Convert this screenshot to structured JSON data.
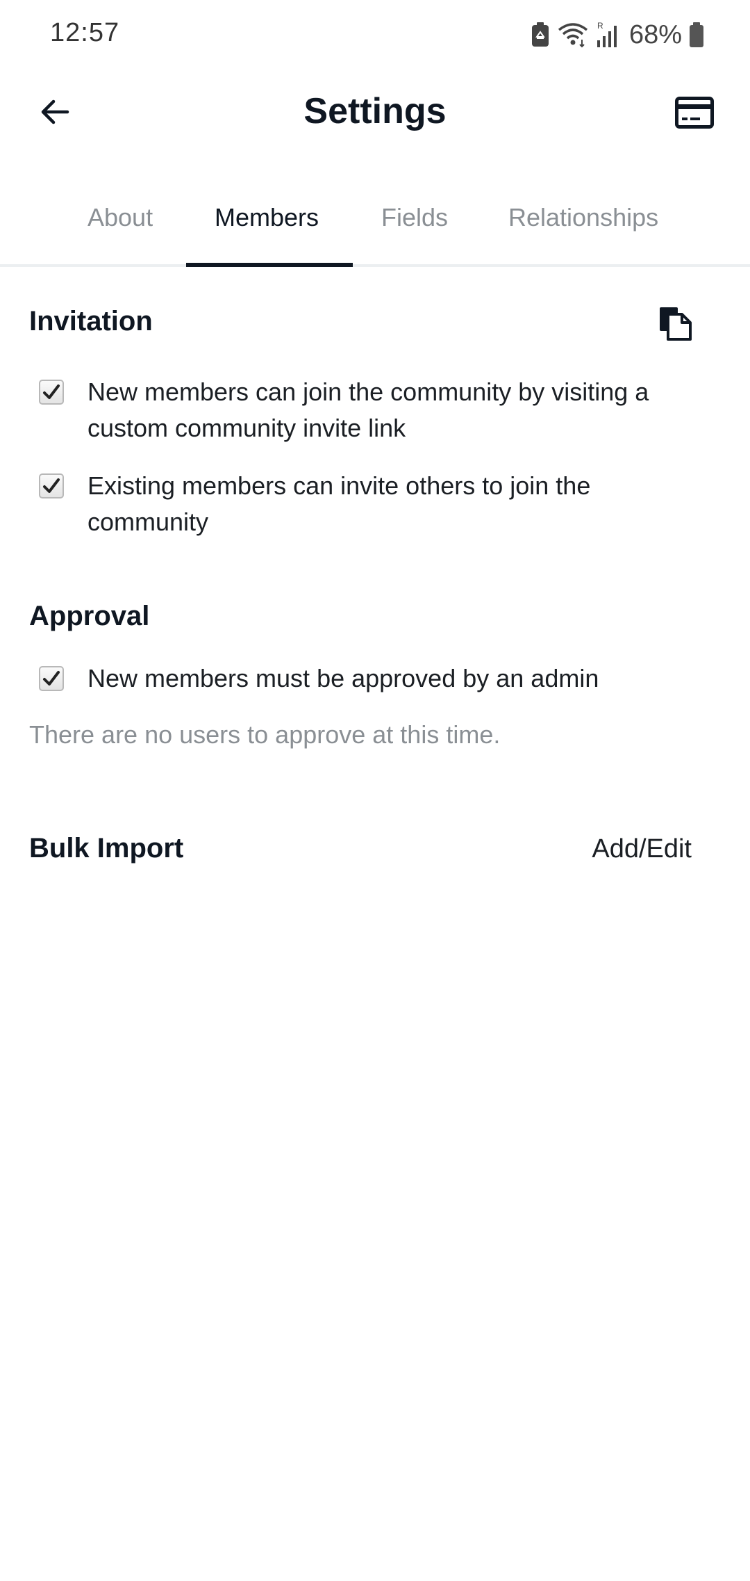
{
  "status_bar": {
    "time": "12:57",
    "battery": "68%",
    "icons": [
      "battery-saver-icon",
      "wifi-icon",
      "signal-icon",
      "battery-icon"
    ]
  },
  "header": {
    "title": "Settings",
    "back_icon": "arrow-left-icon",
    "action_icon": "credit-card-icon"
  },
  "tabs": [
    {
      "label": "About",
      "active": false
    },
    {
      "label": "Members",
      "active": true
    },
    {
      "label": "Fields",
      "active": false
    },
    {
      "label": "Relationships",
      "active": false
    }
  ],
  "invitation": {
    "title": "Invitation",
    "copy_icon": "copy-icon",
    "options": [
      {
        "label": "New members can join the community by visiting a custom community invite link",
        "checked": true
      },
      {
        "label": "Existing members can invite others to join the community",
        "checked": true
      }
    ]
  },
  "approval": {
    "title": "Approval",
    "option": {
      "label": "New members must be approved by an admin",
      "checked": true
    },
    "hint": "There are no users to approve at this time."
  },
  "bulk_import": {
    "title": "Bulk Import",
    "action_label": "Add/Edit"
  },
  "colors": {
    "text_primary": "#0f1722",
    "text_muted": "#8a8f94",
    "tab_underline": "#0f1722",
    "divider": "#eceff1"
  }
}
